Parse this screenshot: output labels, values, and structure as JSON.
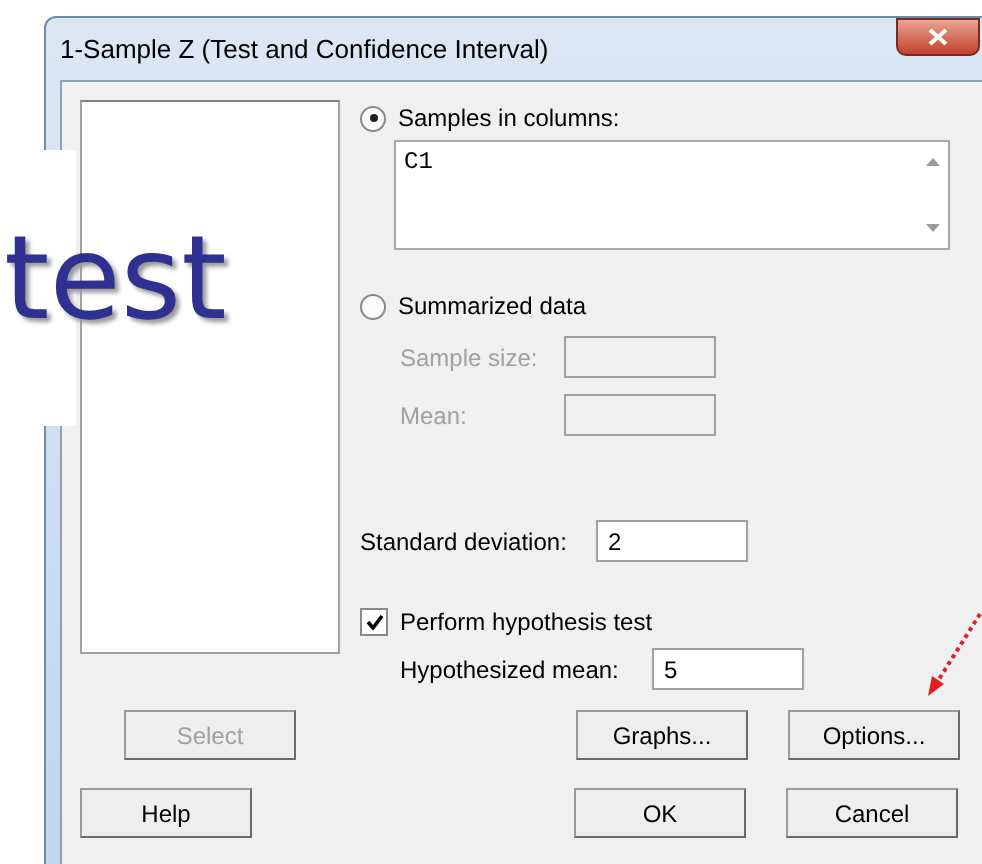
{
  "window": {
    "title": "1-Sample Z (Test and Confidence Interval)"
  },
  "overlay_text": "test",
  "source_options": [
    {
      "label": "Samples in columns:",
      "selected": true
    },
    {
      "label": "Summarized data",
      "selected": false
    }
  ],
  "samples_value": "C1",
  "summarized_fields": [
    {
      "label": "Sample size:",
      "disabled": true
    },
    {
      "label": "Mean:",
      "disabled": true
    }
  ],
  "standard_deviation": {
    "label": "Standard deviation:",
    "value": "2"
  },
  "hypothesis_test": {
    "label": "Perform hypothesis test",
    "checked": true,
    "field_label": "Hypothesized mean:",
    "value": "5"
  },
  "button_rows": [
    [
      {
        "label": "Select",
        "disabled": true,
        "kind": "left"
      },
      {
        "label": "Graphs...",
        "disabled": false,
        "kind": "right"
      },
      {
        "label": "Options...",
        "disabled": false,
        "kind": "right"
      }
    ],
    [
      {
        "label": "Help",
        "disabled": false,
        "kind": "left"
      },
      {
        "label": "OK",
        "disabled": false,
        "kind": "right"
      },
      {
        "label": "Cancel",
        "disabled": false,
        "kind": "right"
      }
    ]
  ]
}
